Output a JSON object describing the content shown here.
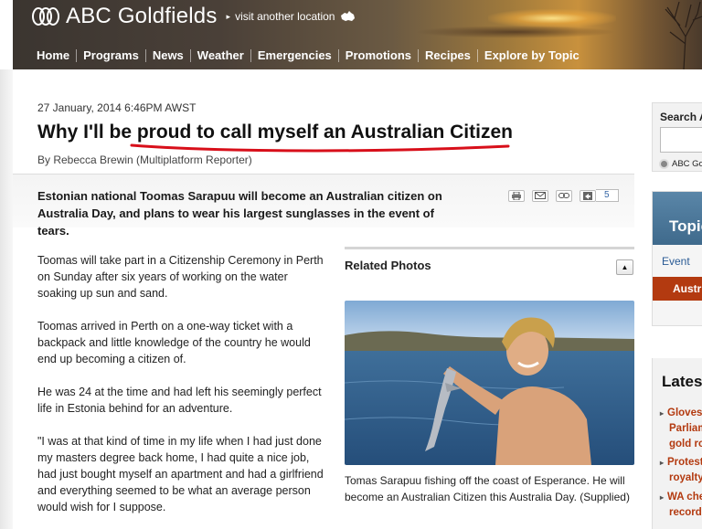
{
  "header": {
    "site_name": "ABC Goldfields",
    "visit_location": "visit another location",
    "nav": [
      "Home",
      "Programs",
      "News",
      "Weather",
      "Emergencies",
      "Promotions",
      "Recipes",
      "Explore by Topic"
    ]
  },
  "article": {
    "date": "27 January, 2014 6:46PM AWST",
    "headline": "Why I'll be proud to call myself an Australian Citizen",
    "byline": "By Rebecca Brewin (Multiplatform Reporter)",
    "summary": "Estonian national Toomas Sarapuu will become an Australian citizen on Australia Day, and plans to wear his largest sunglasses in the event of tears.",
    "share_count": "5",
    "paragraphs": [
      "Toomas will take part in a Citizenship Ceremony in Perth on Sunday after six years of working on the water soaking up sun and sand.",
      "Toomas arrived in Perth on a one-way ticket with a backpack and little knowledge of the country he would end up becoming a citizen of.",
      "He was 24 at the time and had left his seemingly perfect life in Estonia behind for an adventure.",
      "\"I was at that kind of time in my life when I had just done my masters degree back home, I had quite a nice job, had just bought myself an apartment and had a girlfriend and everything seemed to be what an average person would wish for I suppose."
    ]
  },
  "related": {
    "title": "Related Photos",
    "caption": "Tomas Sarapuu fishing off the coast of Esperance. He will become an Australian Citizen this Australia Day. (Supplied)"
  },
  "sidebar": {
    "search_label": "Search A",
    "search_option": "ABC Go",
    "topics_title": "Topic",
    "topics_event": "Event",
    "topics_selected": "Austr",
    "latest_title": "Lates",
    "latest_items": [
      [
        "Gloves",
        "Parliam",
        "gold ro"
      ],
      [
        "Protest",
        "royalty"
      ],
      [
        "WA che",
        "record"
      ]
    ]
  },
  "colors": {
    "accent_red": "#b33a10",
    "link_blue": "#2a5b95",
    "underline_red": "#d80f1a"
  }
}
